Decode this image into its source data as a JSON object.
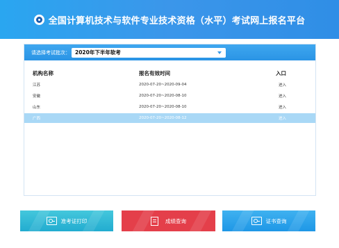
{
  "header": {
    "title": "全国计算机技术与软件专业技术资格（水平）考试网上报名平台",
    "logo_icon": "exam-logo-icon",
    "bg_color": "#3b96ea"
  },
  "batch": {
    "label": "请选择考试批次：",
    "selected": "2020年下半年软考"
  },
  "table": {
    "headers": [
      "机构名称",
      "报名有效时间",
      "入口"
    ],
    "rows": [
      {
        "name": "江苏",
        "period": "2020-07-20~2020-09-04",
        "entry": "进入",
        "selected": false
      },
      {
        "name": "安徽",
        "period": "2020-07-20~2020-08-10",
        "entry": "进入",
        "selected": false
      },
      {
        "name": "山东",
        "period": "2020-07-20~2020-08-10",
        "entry": "进入",
        "selected": false
      },
      {
        "name": "广西",
        "period": "2020-07-20~2020-08-12",
        "entry": "进入",
        "selected": true
      }
    ]
  },
  "buttons": {
    "admit_label": "准考证打印",
    "score_label": "成绩查询",
    "cert_label": "证书查询"
  },
  "colors": {
    "admit_button": "#2fb9d6",
    "score_button": "#e43f4a",
    "cert_button": "#2aa2ea",
    "selected_row": "#a9d8f6"
  }
}
